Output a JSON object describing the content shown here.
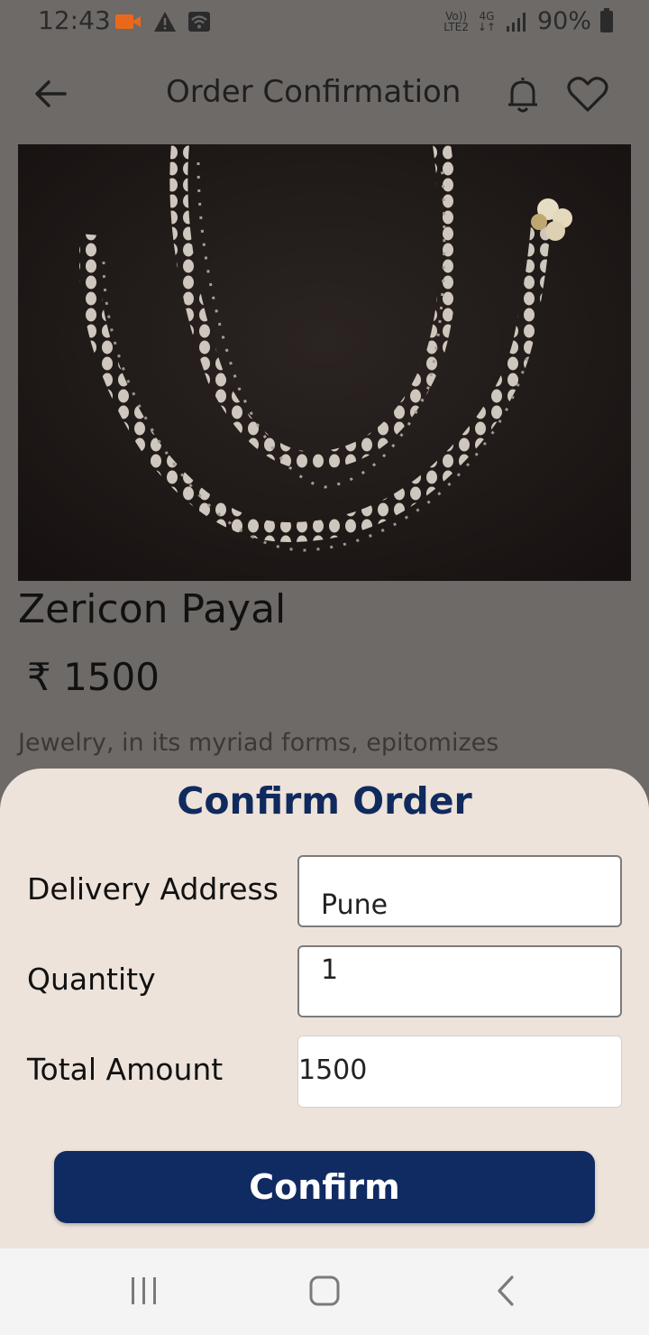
{
  "status_bar": {
    "time": "12:43",
    "network_top": "Vo))",
    "network_bottom": "LTE2",
    "network_type": "4G",
    "battery": "90%",
    "icons": [
      "video-record-icon",
      "warning-icon",
      "wifi-icon",
      "signal-icon",
      "battery-icon"
    ],
    "record_color": "#e8691c"
  },
  "app_bar": {
    "title": "Order Confirmation",
    "icons": [
      "back-arrow-icon",
      "bell-icon",
      "heart-icon"
    ]
  },
  "product": {
    "name": "Zericon Payal",
    "price": "₹ 1500",
    "description": "Jewelry, in its myriad forms, epitomizes"
  },
  "sheet": {
    "title": "Confirm Order",
    "address_label": "Delivery Address",
    "address_value": "Pune",
    "quantity_label": "Quantity",
    "quantity_value": "1",
    "total_label": "Total Amount",
    "total_value": "1500",
    "confirm_label": "Confirm",
    "accent": "#102a62",
    "background": "#ede3da"
  },
  "nav_bar": {
    "icons": [
      "recent-apps-icon",
      "home-icon",
      "back-icon"
    ]
  }
}
